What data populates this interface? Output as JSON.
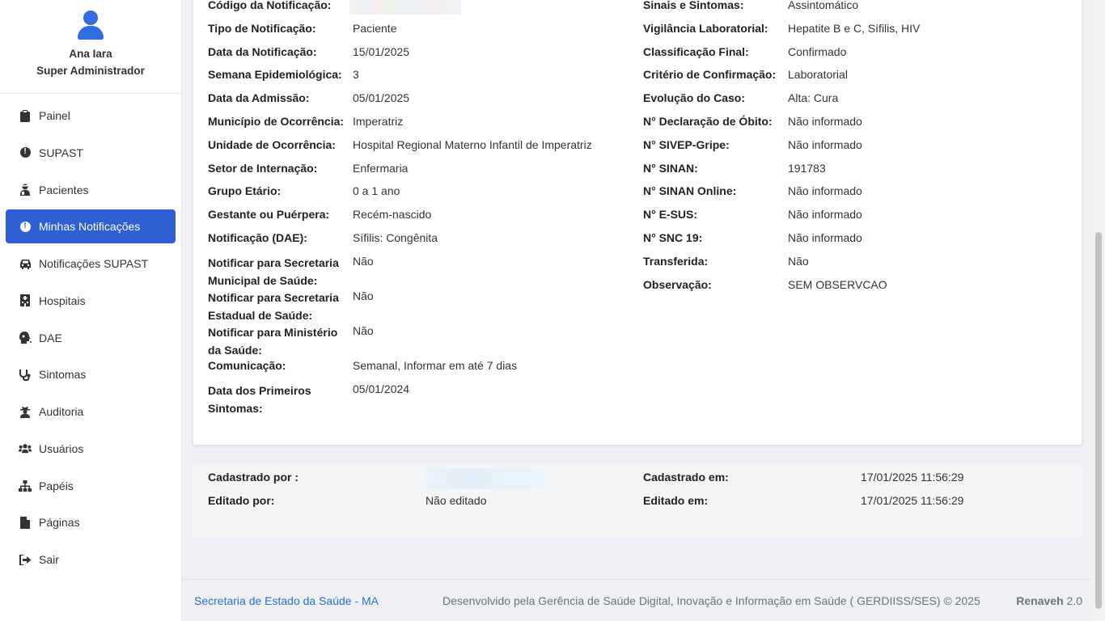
{
  "user": {
    "name": "Ana Iara",
    "role": "Super Administrador"
  },
  "nav": [
    {
      "label": "Painel",
      "icon": "clipboard-icon"
    },
    {
      "label": "SUPAST",
      "icon": "alert-circle-icon"
    },
    {
      "label": "Pacientes",
      "icon": "user-injured-icon"
    },
    {
      "label": "Minhas Notificações",
      "icon": "alert-circle-icon",
      "active": true
    },
    {
      "label": "Notificações SUPAST",
      "icon": "car-icon"
    },
    {
      "label": "Hospitais",
      "icon": "hospital-icon"
    },
    {
      "label": "DAE",
      "icon": "head-virus-icon"
    },
    {
      "label": "Sintomas",
      "icon": "stethoscope-icon"
    },
    {
      "label": "Auditoria",
      "icon": "user-secret-icon"
    },
    {
      "label": "Usuários",
      "icon": "users-icon"
    },
    {
      "label": "Papéis",
      "icon": "sitemap-icon"
    },
    {
      "label": "Páginas",
      "icon": "file-icon"
    },
    {
      "label": "Sair",
      "icon": "sign-out-icon"
    }
  ],
  "details_left": [
    {
      "label": "Código da Notificação:",
      "value": ""
    },
    {
      "label": "Tipo de Notificação:",
      "value": "Paciente"
    },
    {
      "label": "Data da Notificação:",
      "value": "15/01/2025"
    },
    {
      "label": "Semana Epidemiológica:",
      "value": "3"
    },
    {
      "label": "Data da Admissão:",
      "value": "05/01/2025"
    },
    {
      "label": "Município de Ocorrência:",
      "value": "Imperatriz"
    },
    {
      "label": "Unidade de Ocorrência:",
      "value": "Hospital Regional Materno Infantil de Imperatriz"
    },
    {
      "label": "Setor de Internação:",
      "value": "Enfermaria"
    },
    {
      "label": "Grupo Etário:",
      "value": "0 a 1 ano"
    },
    {
      "label": "Gestante ou Puérpera:",
      "value": "Recém-nascido"
    },
    {
      "label": "Notificação (DAE):",
      "value": "Sífilis: Congênita"
    },
    {
      "label": "Notificar para Secretaria Municipal de Saúde:",
      "value": "Não"
    },
    {
      "label": "Notificar para Secretaria Estadual de Saúde:",
      "value": "Não"
    },
    {
      "label": "Notificar para Ministério da Saúde:",
      "value": "Não"
    },
    {
      "label": "Comunicação:",
      "value": "Semanal, Informar em até 7 dias"
    },
    {
      "label": "Data dos Primeiros Sintomas:",
      "value": "05/01/2024"
    }
  ],
  "details_right": [
    {
      "label": "Sinais e Sintomas:",
      "value": "Assintomático"
    },
    {
      "label": "Vigilância Laboratorial:",
      "value": "Hepatite B e C, Sífilis, HIV"
    },
    {
      "label": "Classificação Final:",
      "value": "Confirmado"
    },
    {
      "label": "Critério de Confirmação:",
      "value": "Laboratorial"
    },
    {
      "label": "Evolução do Caso:",
      "value": "Alta: Cura"
    },
    {
      "label": "N° Declaração de Óbito:",
      "value": "Não informado"
    },
    {
      "label": "N° SIVEP-Gripe:",
      "value": "Não informado"
    },
    {
      "label": "N° SINAN:",
      "value": "191783"
    },
    {
      "label": "N° SINAN Online:",
      "value": "Não informado"
    },
    {
      "label": "N° E-SUS:",
      "value": "Não informado"
    },
    {
      "label": "N° SNC 19:",
      "value": "Não informado"
    },
    {
      "label": "Transferida:",
      "value": "Não"
    },
    {
      "label": "Observação:",
      "value": "SEM OBSERVCAO"
    }
  ],
  "meta": {
    "created_by_label": "Cadastrado por :",
    "created_by_value": "",
    "created_at_label": "Cadastrado em:",
    "created_at_value": "17/01/2025 11:56:29",
    "edited_by_label": "Editado por:",
    "edited_by_value": "Não editado",
    "edited_at_label": "Editado em:",
    "edited_at_value": "17/01/2025 11:56:29"
  },
  "footer": {
    "org_link": "Secretaria de Estado da Saúde - MA",
    "credits": "Desenvolvido pela Gerência de Saúde Digital, Inovação e Informação em Saúde ( GERDIISS/SES) © 2025",
    "brand": "Renaveh",
    "version": "2.0"
  },
  "colors": {
    "accent": "#2f5fd3",
    "link": "#2c6fd1"
  }
}
